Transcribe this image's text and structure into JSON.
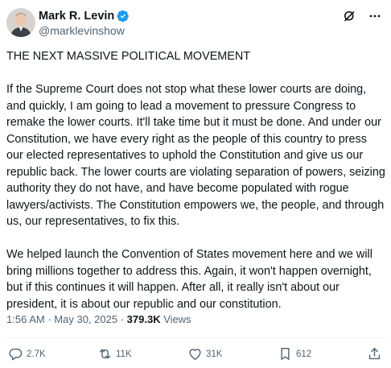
{
  "author": {
    "display_name": "Mark R. Levin",
    "handle": "@marklevinshow",
    "verified": true,
    "avatar_icon": "avatar-photo",
    "verified_color": "#1d9bf0"
  },
  "top_actions": {
    "grok_icon": "grok-icon",
    "more_icon": "more-icon"
  },
  "tweet": {
    "paragraphs": [
      "THE NEXT MASSIVE POLITICAL MOVEMENT",
      "If the Supreme Court does not stop what these lower courts are doing, and quickly, I am going to lead a movement to pressure Congress to remake the lower courts.  It'll take time but it must be done.  And under our Constitution, we have every right as the people of this country to press our elected representatives to uphold the Constitution and give us our republic back.  The lower courts are violating separation of powers, seizing authority they do not have, and have become populated with rogue lawyers/activists.  The Constitution empowers we, the people, and through us, our representatives, to fix this.",
      "We helped launch the Convention of States movement here and we will bring millions together to address this.  Again, it won't happen overnight, but if this continues it will happen.  After all, it really isn't about our president, it is about our republic and our constitution."
    ]
  },
  "meta": {
    "time": "1:56 AM",
    "separator": "·",
    "date": "May 30, 2025",
    "views_count": "379.3K",
    "views_label": "Views"
  },
  "actions": {
    "replies": "2.7K",
    "reposts": "11K",
    "likes": "31K",
    "bookmarks": "612"
  }
}
